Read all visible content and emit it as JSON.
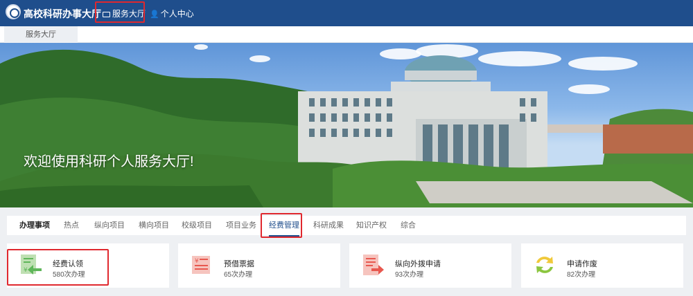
{
  "header": {
    "brand": "高校科研办事大厅",
    "nav": [
      {
        "label": "服务大厅",
        "icon": "monitor-icon"
      },
      {
        "label": "个人中心",
        "icon": "person-icon"
      }
    ]
  },
  "breadcrumb": {
    "label": "服务大厅"
  },
  "banner": {
    "welcome": "欢迎使用科研个人服务大厅!"
  },
  "tabs": {
    "section_title": "办理事项",
    "items": [
      "热点",
      "纵向项目",
      "横向项目",
      "校级项目",
      "项目业务",
      "经费管理",
      "科研成果",
      "知识产权",
      "综合"
    ],
    "active": "经费管理"
  },
  "cards": [
    {
      "title": "经费认领",
      "count": "580次办理",
      "icon": "yen-arrow-in-icon",
      "color": "#5fb65a"
    },
    {
      "title": "预借票据",
      "count": "65次办理",
      "icon": "yen-document-icon",
      "color": "#e8584f"
    },
    {
      "title": "纵向外拨申请",
      "count": "93次办理",
      "icon": "document-arrow-out-icon",
      "color": "#e8584f"
    },
    {
      "title": "申请作废",
      "count": "82次办理",
      "icon": "refresh-arrows-icon",
      "color": "#8cc640"
    }
  ]
}
